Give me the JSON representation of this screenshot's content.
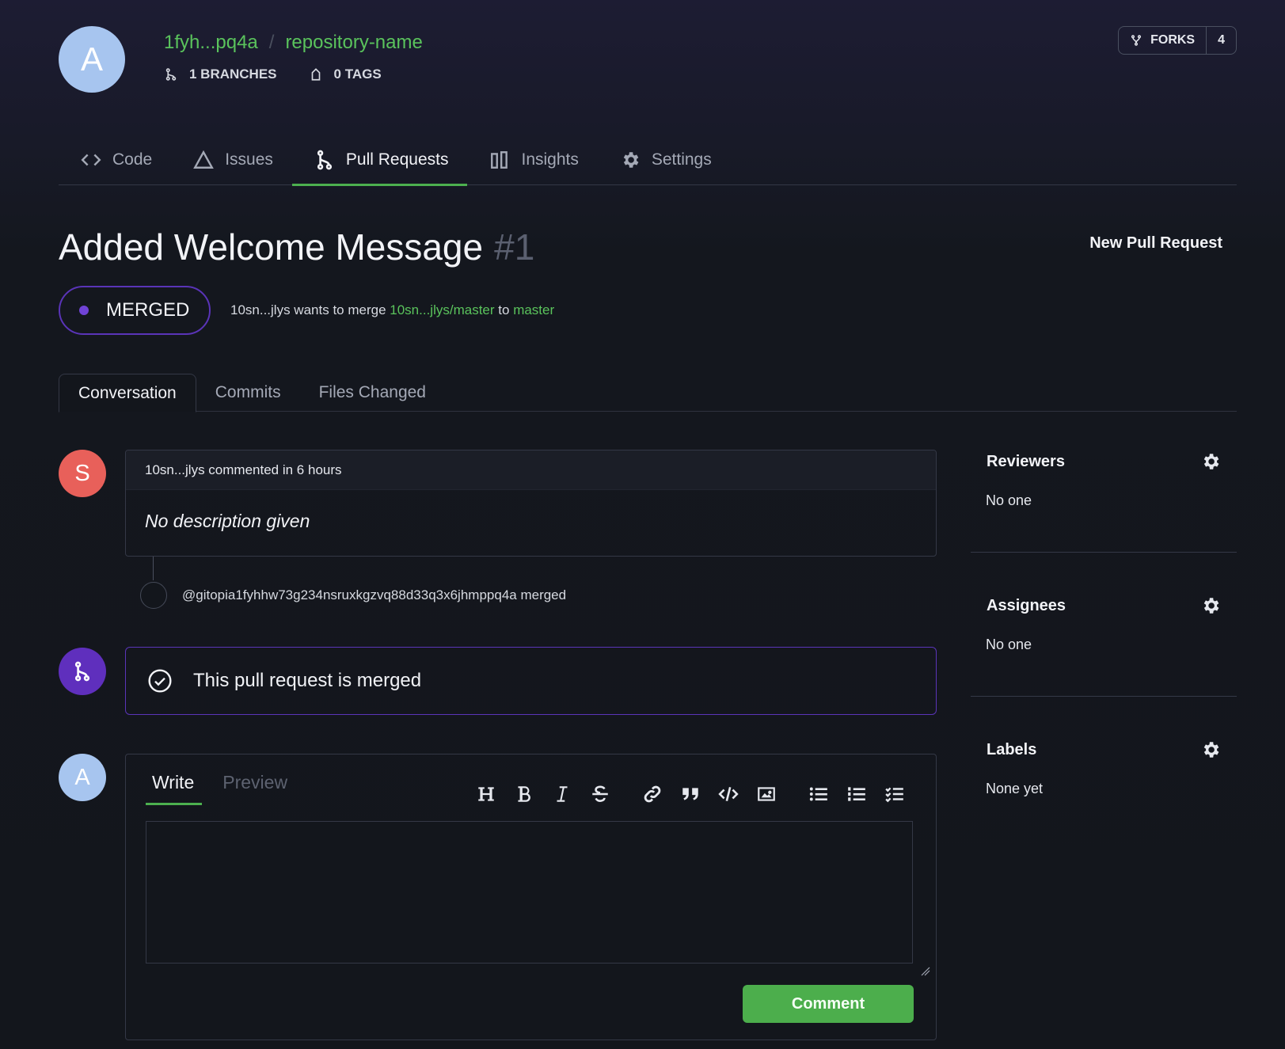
{
  "repo": {
    "avatar_letter": "A",
    "owner": "1fyh...pq4a",
    "separator": "/",
    "name": "repository-name",
    "branches_label": "1 BRANCHES",
    "tags_label": "0 TAGS",
    "forks_label": "FORKS",
    "forks_count": "4"
  },
  "nav": {
    "tabs": [
      {
        "label": "Code",
        "icon": "code-icon"
      },
      {
        "label": "Issues",
        "icon": "issues-icon"
      },
      {
        "label": "Pull Requests",
        "icon": "pull-request-icon",
        "active": true
      },
      {
        "label": "Insights",
        "icon": "insights-icon"
      },
      {
        "label": "Settings",
        "icon": "gear-icon"
      }
    ]
  },
  "pr": {
    "title": "Added Welcome Message",
    "number": "#1",
    "new_pr_label": "New Pull Request",
    "status": "MERGED",
    "merge_user": "10sn...jlys wants to merge",
    "merge_from": "10sn...jlys/master",
    "merge_to_word": "to",
    "merge_to": "master"
  },
  "subtabs": [
    "Conversation",
    "Commits",
    "Files Changed"
  ],
  "timeline": {
    "comment_avatar": "S",
    "comment_header": "10sn...jlys commented in 6 hours",
    "comment_body": "No description given",
    "event_text": "@gitopia1fyhhw73g234nsruxkgzvq88d33q3x6jhmppq4a merged",
    "merged_message": "This pull request is merged"
  },
  "editor": {
    "avatar": "A",
    "write_tab": "Write",
    "preview_tab": "Preview",
    "textarea_value": "",
    "comment_button": "Comment",
    "toolbar": [
      "heading-icon",
      "bold-icon",
      "italic-icon",
      "strikethrough-icon",
      "link-icon",
      "quote-icon",
      "code-icon",
      "image-icon",
      "bullet-list-icon",
      "numbered-list-icon",
      "task-list-icon"
    ]
  },
  "sidebar": {
    "reviewers_title": "Reviewers",
    "reviewers_value": "No one",
    "assignees_title": "Assignees",
    "assignees_value": "No one",
    "labels_title": "Labels",
    "labels_value": "None yet"
  },
  "colors": {
    "accent_green": "#4cb04f",
    "merged_purple": "#5f2fbd",
    "background": "#13161c"
  }
}
